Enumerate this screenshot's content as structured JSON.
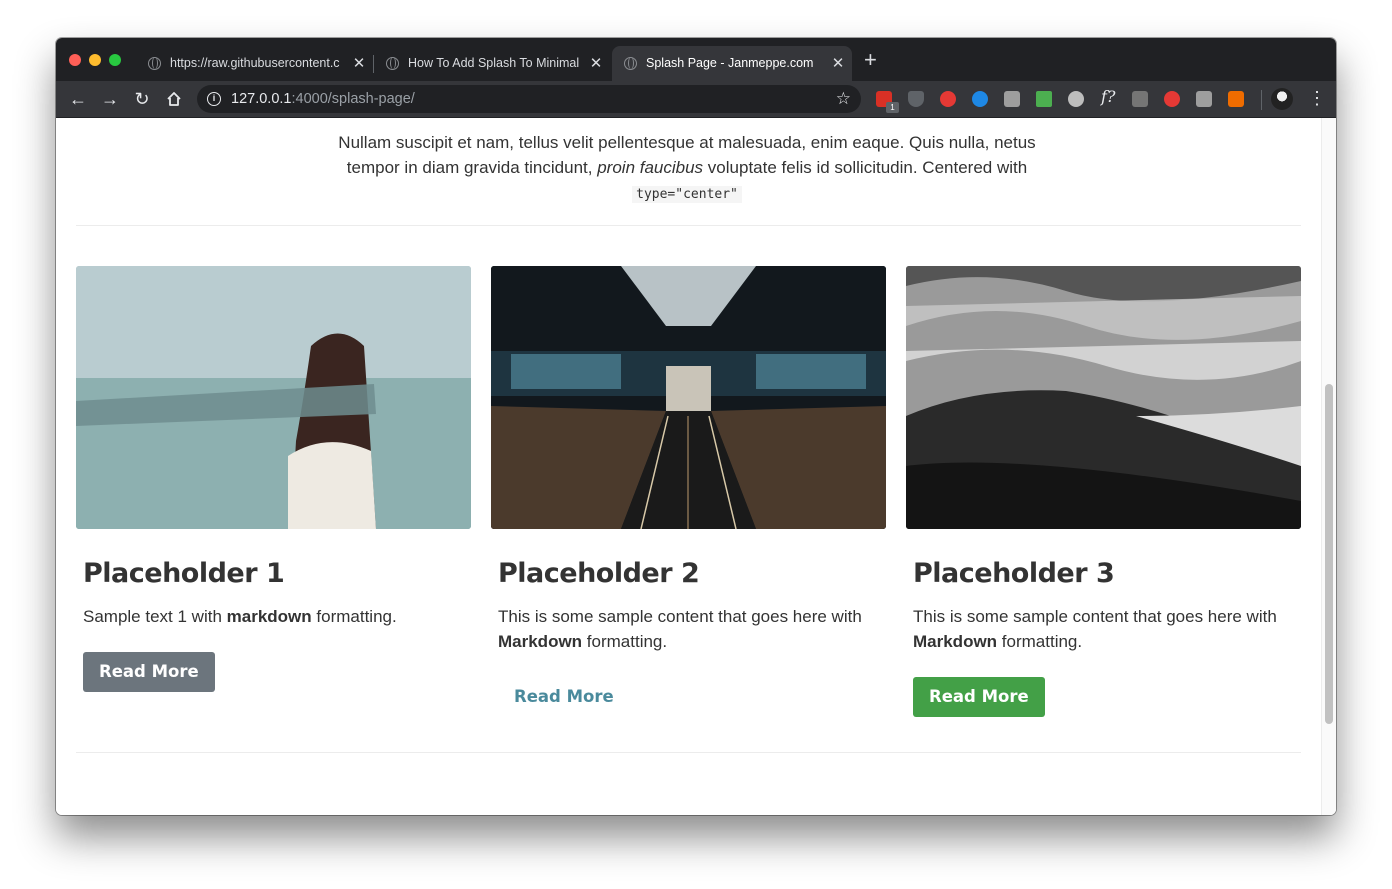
{
  "browser": {
    "tabs": [
      {
        "title": "https://raw.githubusercontent.c",
        "active": false
      },
      {
        "title": "How To Add Splash To Minimal",
        "active": false
      },
      {
        "title": "Splash Page - Janmeppe.com",
        "active": true
      }
    ],
    "new_tab_symbol": "+",
    "close_symbol": "✕",
    "url_host": "127.0.0.1",
    "url_rest": ":4000/splash-page/",
    "extension_badge": "1",
    "extension_fn_label": "f?"
  },
  "page": {
    "intro": {
      "text_before": "Nullam suscipit et nam, tellus velit pellentesque at malesuada, enim eaque. Quis nulla, netus tempor in diam gravida tincidunt,",
      "emphasis": "proin faucibus",
      "text_after": "voluptate felis id sollicitudin. Centered with",
      "code": "type=\"center\""
    },
    "cards": [
      {
        "title": "Placeholder 1",
        "text_before": "Sample text 1 with",
        "bold": "markdown",
        "text_after": "formatting.",
        "button": "Read More",
        "button_style": "gray"
      },
      {
        "title": "Placeholder 2",
        "text_before": "This is some sample content that goes here with",
        "bold": "Markdown",
        "text_after": "formatting.",
        "button": "Read More",
        "button_style": "link"
      },
      {
        "title": "Placeholder 3",
        "text_before": "This is some sample content that goes here with",
        "bold": "Markdown",
        "text_after": "formatting.",
        "button": "Read More",
        "button_style": "green"
      }
    ]
  },
  "colors": {
    "button_gray": "#6c757d",
    "button_link": "#4a8a9c",
    "button_green": "#43a047",
    "tabstrip": "#202124",
    "toolbar": "#35363a"
  }
}
